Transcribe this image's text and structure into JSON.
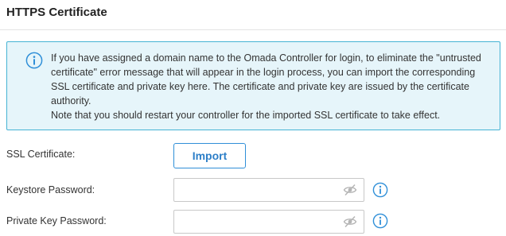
{
  "section": {
    "title": "HTTPS Certificate"
  },
  "notice": {
    "icon": "info-icon",
    "text": "If you have assigned a domain name to the Omada Controller for login, to eliminate the \"untrusted certificate\" error message that will appear in the login process, you can import the corresponding SSL certificate and private key here. The certificate and private key are issued by the certificate authority.",
    "note": "Note that you should restart your controller for the imported SSL certificate to take effect."
  },
  "form": {
    "ssl_label": "SSL Certificate:",
    "import_label": "Import",
    "keystore_label": "Keystore Password:",
    "keystore_value": "",
    "private_key_label": "Private Key Password:",
    "private_key_value": ""
  },
  "colors": {
    "accent": "#2f8fd8",
    "notice_bg": "#e6f5fa",
    "notice_border": "#45b3d4"
  }
}
